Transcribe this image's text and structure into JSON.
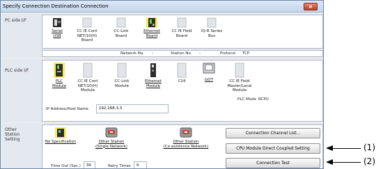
{
  "window": {
    "title": "Specify Connection Destination Connection",
    "close_glyph": "×"
  },
  "pc_side": {
    "label": "PC side I/F",
    "items": [
      {
        "icon": "serial-usb-icon",
        "line1": "Serial",
        "line2": "USB",
        "line3": ""
      },
      {
        "icon": "cc-ie-cont-board-icon",
        "line1": "CC IE Cont",
        "line2": "NET/10(H)",
        "line3": "Board"
      },
      {
        "icon": "cc-link-board-icon",
        "line1": "CC-Link",
        "line2": "Board",
        "line3": ""
      },
      {
        "icon": "ethernet-board-icon",
        "line1": "Ethernet",
        "line2": "Board",
        "line3": ""
      },
      {
        "icon": "cc-ie-field-board-icon",
        "line1": "CC IE Field",
        "line2": "Board",
        "line3": ""
      },
      {
        "icon": "iq-r-series-bus-icon",
        "line1": "iQ-R Series",
        "line2": "Bus",
        "line3": ""
      }
    ],
    "network_no_label": "Network No.",
    "network_no_value": "-",
    "station_no_label": "Station No.",
    "station_no_value": "-",
    "protocol_label": "Protocol",
    "protocol_value": "TCP"
  },
  "plc_side": {
    "label": "PLC side I/F",
    "items": [
      {
        "icon": "plc-module-icon",
        "line1": "PLC",
        "line2": "Module",
        "line3": ""
      },
      {
        "icon": "cc-ie-cont-module-icon",
        "line1": "CC IE Cont",
        "line2": "NET/10(H)",
        "line3": "Module"
      },
      {
        "icon": "cc-link-module-icon",
        "line1": "CC-Link",
        "line2": "Module",
        "line3": ""
      },
      {
        "icon": "ethernet-module-icon",
        "line1": "Ethernet",
        "line2": "Module",
        "line3": ""
      },
      {
        "icon": "c24-icon",
        "line1": "C24",
        "line2": "",
        "line3": ""
      },
      {
        "icon": "got-icon",
        "line1": "GOT",
        "line2": "",
        "line3": ""
      },
      {
        "icon": "cc-ie-field-master-icon",
        "line1": "CC IE Field",
        "line2": "Master/Local",
        "line3": "Module"
      }
    ],
    "plc_mode_label": "PLC Mode",
    "plc_mode_value": "RCPU",
    "ip_label": "IP Address/Host Name",
    "ip_value": "192.168.3.3"
  },
  "other_station": {
    "label_line1": "Other",
    "label_line2": "Station",
    "label_line3": "Setting",
    "items": [
      {
        "icon": "no-specification-icon",
        "line1": "No Specification",
        "line2": ""
      },
      {
        "icon": "single-network-icon",
        "line1": "Other Station",
        "line2": "(Single Network)"
      },
      {
        "icon": "co-existence-network-icon",
        "line1": "Other Station",
        "line2": "(Co-existence Network)"
      }
    ],
    "timeout_label": "Time Out (Sec.)",
    "timeout_value": "30",
    "retry_label": "Retry Times",
    "retry_value": "0"
  },
  "buttons": {
    "channel_list": "Connection Channel List...",
    "cpu_direct": "CPU Module Direct Coupled Setting",
    "test": "Connection Test"
  },
  "callouts": {
    "one": "(1)",
    "two": "(2)"
  }
}
